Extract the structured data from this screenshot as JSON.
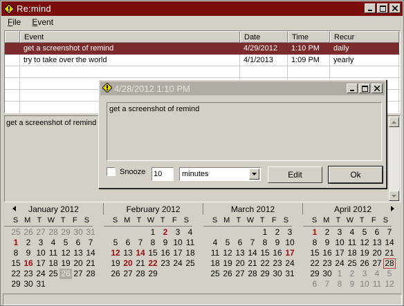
{
  "window": {
    "title": "Re:mind"
  },
  "menu": {
    "file": "File",
    "event": "Event"
  },
  "list": {
    "columns": [
      "",
      "Event",
      "Date",
      "Time",
      "Recur"
    ],
    "rows": [
      {
        "event": "get a screenshot of remind",
        "date": "4/29/2012",
        "time": "1:10 PM",
        "recur": "daily",
        "selected": true
      },
      {
        "event": "try to take over the world",
        "date": "4/1/2013",
        "time": "1:09 PM",
        "recur": "yearly",
        "selected": false
      }
    ]
  },
  "detail": {
    "text": "get a screenshot of remind"
  },
  "popup": {
    "title": "4/28/2012 1:10 PM",
    "message": "get a screenshot of remind",
    "snooze_label": "Snooze",
    "snooze_value": "10",
    "unit": "minutes",
    "edit_label": "Edit",
    "ok_label": "Ok"
  },
  "calendar": {
    "dow": [
      "S",
      "M",
      "T",
      "W",
      "T",
      "F",
      "S"
    ],
    "months": [
      {
        "title": "January 2012",
        "days": [
          {
            "d": "25",
            "o": 1
          },
          {
            "d": "26",
            "o": 1
          },
          {
            "d": "27",
            "o": 1
          },
          {
            "d": "28",
            "o": 1
          },
          {
            "d": "29",
            "o": 1
          },
          {
            "d": "30",
            "o": 1
          },
          {
            "d": "31",
            "o": 1
          },
          {
            "d": "1",
            "b": 1
          },
          {
            "d": "2"
          },
          {
            "d": "3"
          },
          {
            "d": "4"
          },
          {
            "d": "5"
          },
          {
            "d": "6"
          },
          {
            "d": "7"
          },
          {
            "d": "8"
          },
          {
            "d": "9"
          },
          {
            "d": "10"
          },
          {
            "d": "11"
          },
          {
            "d": "12"
          },
          {
            "d": "13"
          },
          {
            "d": "14"
          },
          {
            "d": "15"
          },
          {
            "d": "16",
            "b": 1
          },
          {
            "d": "17"
          },
          {
            "d": "18"
          },
          {
            "d": "19"
          },
          {
            "d": "20"
          },
          {
            "d": "21"
          },
          {
            "d": "22"
          },
          {
            "d": "23"
          },
          {
            "d": "24"
          },
          {
            "d": "25"
          },
          {
            "d": "26",
            "t": 1
          },
          {
            "d": "27"
          },
          {
            "d": "28"
          },
          {
            "d": "29"
          },
          {
            "d": "30"
          },
          {
            "d": "31"
          }
        ]
      },
      {
        "title": "February 2012",
        "days": [
          {
            "d": ""
          },
          {
            "d": ""
          },
          {
            "d": ""
          },
          {
            "d": "1"
          },
          {
            "d": "2",
            "b": 1
          },
          {
            "d": "3"
          },
          {
            "d": "4"
          },
          {
            "d": "5"
          },
          {
            "d": "6"
          },
          {
            "d": "7"
          },
          {
            "d": "8"
          },
          {
            "d": "9"
          },
          {
            "d": "10"
          },
          {
            "d": "11"
          },
          {
            "d": "12",
            "b": 1
          },
          {
            "d": "13"
          },
          {
            "d": "14",
            "b": 1
          },
          {
            "d": "15"
          },
          {
            "d": "16"
          },
          {
            "d": "17"
          },
          {
            "d": "18"
          },
          {
            "d": "19"
          },
          {
            "d": "20",
            "b": 1
          },
          {
            "d": "21"
          },
          {
            "d": "22",
            "b": 1
          },
          {
            "d": "23"
          },
          {
            "d": "24"
          },
          {
            "d": "25"
          },
          {
            "d": "26"
          },
          {
            "d": "27"
          },
          {
            "d": "28"
          },
          {
            "d": "29"
          }
        ]
      },
      {
        "title": "March 2012",
        "days": [
          {
            "d": ""
          },
          {
            "d": ""
          },
          {
            "d": ""
          },
          {
            "d": ""
          },
          {
            "d": "1"
          },
          {
            "d": "2"
          },
          {
            "d": "3"
          },
          {
            "d": "4"
          },
          {
            "d": "5"
          },
          {
            "d": "6"
          },
          {
            "d": "7"
          },
          {
            "d": "8"
          },
          {
            "d": "9"
          },
          {
            "d": "10"
          },
          {
            "d": "11"
          },
          {
            "d": "12"
          },
          {
            "d": "13"
          },
          {
            "d": "14"
          },
          {
            "d": "15"
          },
          {
            "d": "16"
          },
          {
            "d": "17",
            "b": 1
          },
          {
            "d": "18"
          },
          {
            "d": "19"
          },
          {
            "d": "20"
          },
          {
            "d": "21"
          },
          {
            "d": "22"
          },
          {
            "d": "23"
          },
          {
            "d": "24"
          },
          {
            "d": "25"
          },
          {
            "d": "26"
          },
          {
            "d": "27"
          },
          {
            "d": "28"
          },
          {
            "d": "29"
          },
          {
            "d": "30"
          },
          {
            "d": "31"
          }
        ]
      },
      {
        "title": "April 2012",
        "days": [
          {
            "d": "1",
            "b": 1
          },
          {
            "d": "2"
          },
          {
            "d": "3"
          },
          {
            "d": "4"
          },
          {
            "d": "5"
          },
          {
            "d": "6"
          },
          {
            "d": "7"
          },
          {
            "d": "8"
          },
          {
            "d": "9"
          },
          {
            "d": "10"
          },
          {
            "d": "11"
          },
          {
            "d": "12"
          },
          {
            "d": "13"
          },
          {
            "d": "14"
          },
          {
            "d": "15"
          },
          {
            "d": "16"
          },
          {
            "d": "17"
          },
          {
            "d": "18"
          },
          {
            "d": "19"
          },
          {
            "d": "20"
          },
          {
            "d": "21"
          },
          {
            "d": "22"
          },
          {
            "d": "23"
          },
          {
            "d": "24"
          },
          {
            "d": "25"
          },
          {
            "d": "26"
          },
          {
            "d": "27"
          },
          {
            "d": "28",
            "c": 1
          },
          {
            "d": "29"
          },
          {
            "d": "30"
          },
          {
            "d": "1",
            "o": 1
          },
          {
            "d": "2",
            "o": 1
          },
          {
            "d": "3",
            "o": 1
          },
          {
            "d": "4",
            "o": 1
          },
          {
            "d": "5",
            "o": 1
          },
          {
            "d": "6",
            "o": 1
          },
          {
            "d": "7",
            "o": 1
          },
          {
            "d": "8",
            "o": 1
          },
          {
            "d": "9",
            "o": 1
          },
          {
            "d": "10",
            "o": 1
          },
          {
            "d": "11",
            "o": 1
          },
          {
            "d": "12",
            "o": 1
          }
        ]
      }
    ]
  },
  "colors": {
    "titlebar": "#7b0d0d",
    "selection": "#7b2b2b",
    "bold_day": "#9a0d0d"
  }
}
